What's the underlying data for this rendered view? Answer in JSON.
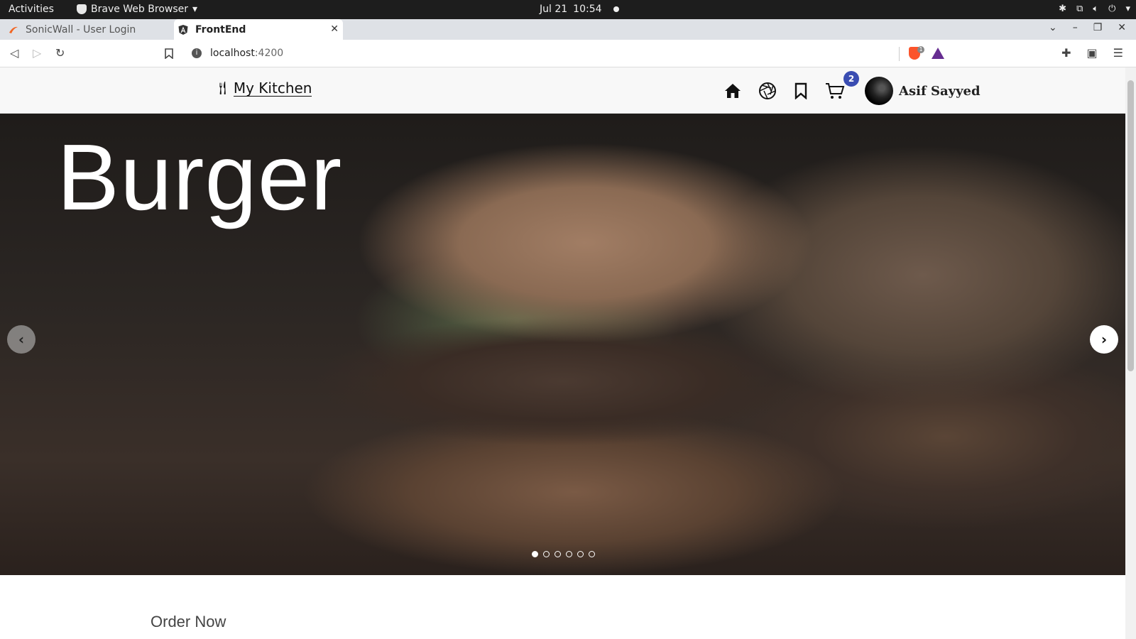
{
  "system_bar": {
    "activities": "Activities",
    "app_name": "Brave Web Browser",
    "date": "Jul 21",
    "time": "10:54"
  },
  "browser": {
    "tabs": [
      {
        "title": "SonicWall - User Login",
        "active": false
      },
      {
        "title": "FrontEnd",
        "active": true
      }
    ],
    "address": {
      "host": "localhost",
      "port": ":4200"
    },
    "shield_count": "1"
  },
  "site": {
    "logo_text": "My Kitchen",
    "cart_count": "2",
    "user_name": "Asif Sayyed"
  },
  "hero": {
    "title": "Burger",
    "slide_count": 6,
    "active_slide": 1
  },
  "section": {
    "heading": "Order Now"
  },
  "colors": {
    "cart_badge": "#3a4db2",
    "topbar": "#1d1d1d",
    "tabstrip": "#dee1e6"
  }
}
